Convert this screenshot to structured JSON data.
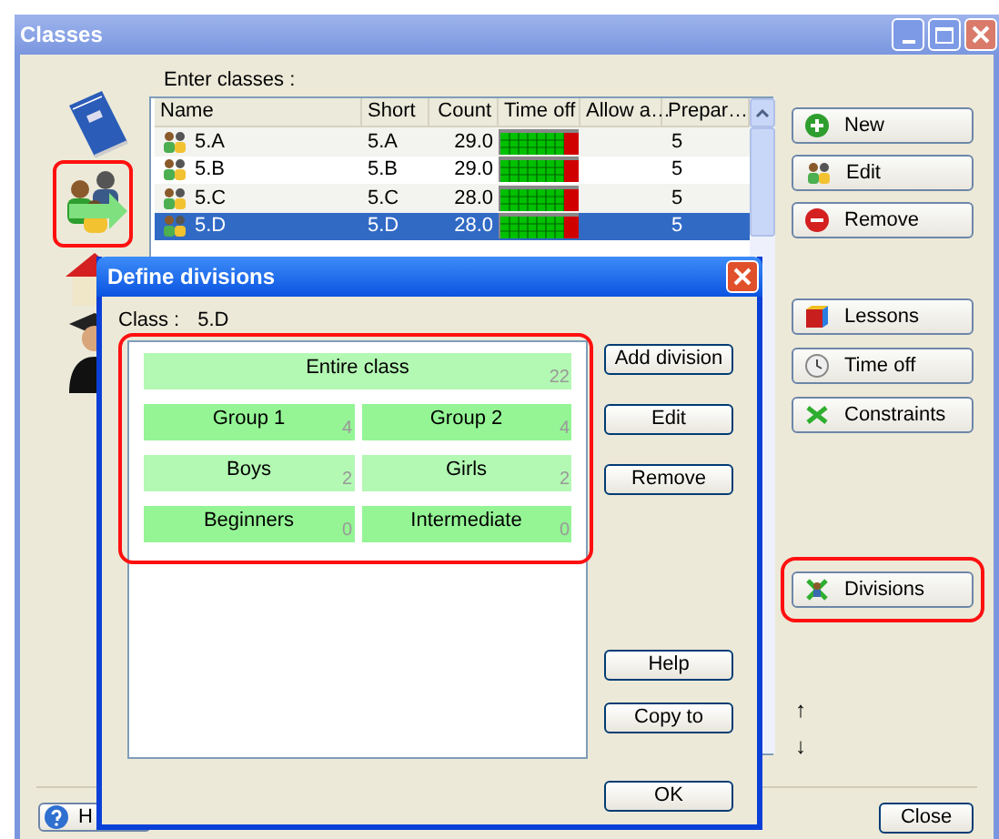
{
  "window": {
    "title": "Classes"
  },
  "sidebar": {
    "items": [
      {
        "kind": "notebook",
        "highlighted": false
      },
      {
        "kind": "group",
        "highlighted": true
      },
      {
        "kind": "house",
        "highlighted": false
      },
      {
        "kind": "graduate",
        "highlighted": false
      }
    ]
  },
  "classes": {
    "label": "Enter classes :",
    "columns": [
      "Name",
      "Short",
      "Count",
      "Time off",
      "Allow a…",
      "Prepar…"
    ],
    "rows": [
      {
        "name": "5.A",
        "short": "5.A",
        "count": "29.0",
        "column_6": "5",
        "selected": false
      },
      {
        "name": "5.B",
        "short": "5.B",
        "count": "29.0",
        "column_6": "5",
        "selected": false
      },
      {
        "name": "5.C",
        "short": "5.C",
        "count": "28.0",
        "column_6": "5",
        "selected": false
      },
      {
        "name": "5.D",
        "short": "5.D",
        "count": "28.0",
        "column_6": "5",
        "selected": true
      }
    ]
  },
  "actions": [
    {
      "label": "New",
      "kind": "plus",
      "highlighted": false
    },
    {
      "label": "Edit",
      "kind": "people",
      "highlighted": false
    },
    {
      "label": "Remove",
      "kind": "minus",
      "highlighted": false
    },
    {
      "label": "Lessons",
      "kind": "cube",
      "highlighted": false
    },
    {
      "label": "Time off",
      "kind": "clock",
      "highlighted": false
    },
    {
      "label": "Constraints",
      "kind": "cross",
      "highlighted": false
    },
    {
      "label": "Divisions",
      "kind": "split",
      "highlighted": true
    }
  ],
  "move": {
    "up": "↑",
    "down": "↓"
  },
  "footer": {
    "help": "H",
    "close": "Close"
  },
  "dialog": {
    "title": "Define divisions",
    "class_label": "Class :",
    "class_value": "5.D",
    "highlighted": true,
    "rows": [
      {
        "tiles": [
          {
            "label": "Entire class",
            "count": "22",
            "color": "#b3f8b3"
          }
        ]
      },
      {
        "tiles": [
          {
            "label": "Group 1",
            "count": "4",
            "color": "#95f595"
          },
          {
            "label": "Group 2",
            "count": "4",
            "color": "#95f595"
          }
        ]
      },
      {
        "tiles": [
          {
            "label": "Boys",
            "count": "2",
            "color": "#b3f8b3"
          },
          {
            "label": "Girls",
            "count": "2",
            "color": "#b3f8b3"
          }
        ]
      },
      {
        "tiles": [
          {
            "label": "Beginners",
            "count": "0",
            "color": "#95f595"
          },
          {
            "label": "Intermediate",
            "count": "0",
            "color": "#95f595"
          }
        ]
      }
    ],
    "buttons": [
      "Add division",
      "Edit",
      "Remove"
    ],
    "lower_buttons": [
      "Help",
      "Copy to"
    ],
    "ok": "OK"
  }
}
